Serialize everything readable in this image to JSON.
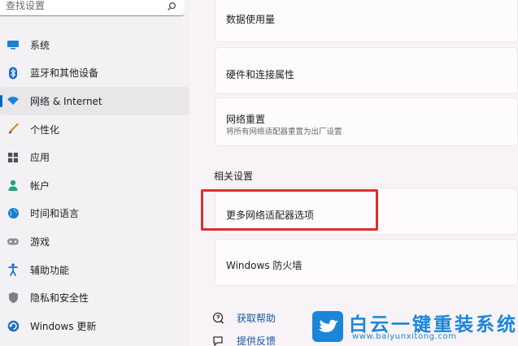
{
  "search": {
    "placeholder": "查找设置"
  },
  "sidebar": {
    "items": [
      {
        "label": "系统",
        "icon": "monitor-icon"
      },
      {
        "label": "蓝牙和其他设备",
        "icon": "bluetooth-icon"
      },
      {
        "label": "网络 & Internet",
        "icon": "wifi-icon",
        "active": true
      },
      {
        "label": "个性化",
        "icon": "brush-icon"
      },
      {
        "label": "应用",
        "icon": "apps-icon"
      },
      {
        "label": "帐户",
        "icon": "person-icon"
      },
      {
        "label": "时间和语言",
        "icon": "globe-clock-icon"
      },
      {
        "label": "游戏",
        "icon": "gamepad-icon"
      },
      {
        "label": "辅助功能",
        "icon": "accessibility-icon"
      },
      {
        "label": "隐私和安全性",
        "icon": "shield-icon"
      },
      {
        "label": "Windows 更新",
        "icon": "update-icon"
      }
    ]
  },
  "main": {
    "cards": [
      {
        "title": "数据使用量"
      },
      {
        "title": "硬件和连接属性"
      },
      {
        "title": "网络重置",
        "subtitle": "将所有网络适配器重置为出厂设置"
      }
    ],
    "related_heading": "相关设置",
    "related": [
      {
        "title": "更多网络适配器选项"
      },
      {
        "title": "Windows 防火墙"
      }
    ],
    "links": [
      {
        "label": "获取帮助",
        "icon": "help-icon"
      },
      {
        "label": "提供反馈",
        "icon": "feedback-icon"
      }
    ]
  },
  "watermark": {
    "title": "白云一键重装系统",
    "url": "www.baiyunxitong.com"
  },
  "colors": {
    "accent": "#0067c0",
    "highlight_border": "#d93030",
    "watermark": "#1a86d8",
    "link": "#1b57a7"
  }
}
